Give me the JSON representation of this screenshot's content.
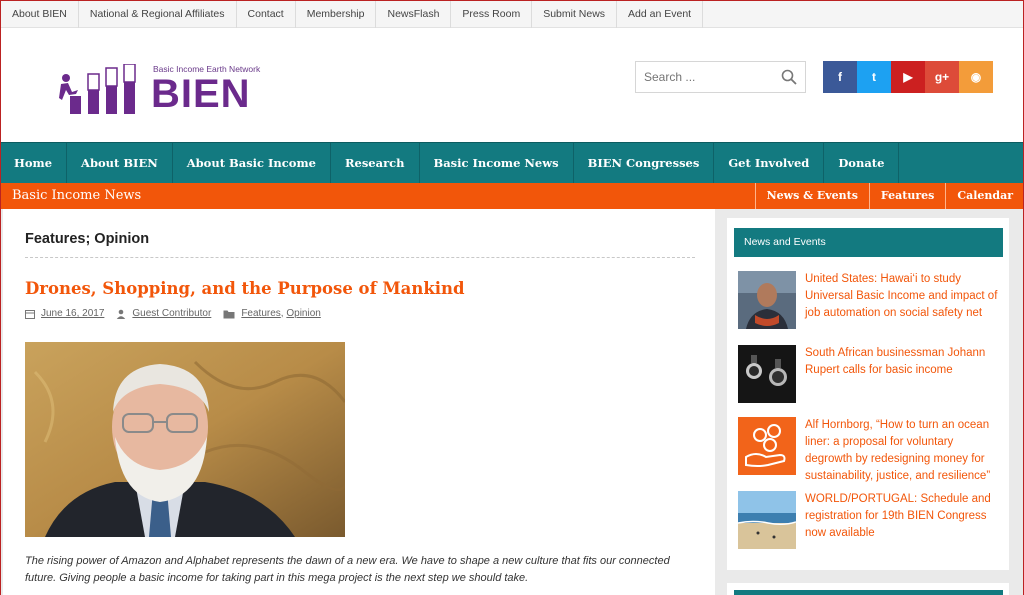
{
  "topbar": {
    "links": [
      "About BIEN",
      "National & Regional Affiliates",
      "Contact",
      "Membership",
      "NewsFlash",
      "Press Room",
      "Submit News",
      "Add an Event"
    ]
  },
  "logo": {
    "subtitle": "Basic Income Earth Network",
    "name": "BIEN"
  },
  "search": {
    "placeholder": "Search ..."
  },
  "social": [
    {
      "icon": "facebook-icon",
      "glyph": "f",
      "color": "#3b5998"
    },
    {
      "icon": "twitter-icon",
      "glyph": "t",
      "color": "#1da1f2"
    },
    {
      "icon": "youtube-icon",
      "glyph": "▶",
      "color": "#cc2020"
    },
    {
      "icon": "google-plus-icon",
      "glyph": "g+",
      "color": "#dd4b39"
    },
    {
      "icon": "rss-icon",
      "glyph": "◉",
      "color": "#f39c3a"
    }
  ],
  "mainnav": {
    "items": [
      "Home",
      "About BIEN",
      "About Basic Income",
      "Research",
      "Basic Income News",
      "BIEN Congresses",
      "Get Involved",
      "Donate"
    ]
  },
  "catbar": {
    "title": "Basic Income News",
    "links": [
      "News & Events",
      "Features",
      "Calendar"
    ]
  },
  "main": {
    "page_title": "Features; Opinion",
    "post_title": "Drones, Shopping, and the Purpose of Mankind",
    "date": "June 16, 2017",
    "author": "Guest Contributor",
    "categories": [
      "Features",
      "Opinion"
    ],
    "category_separator": ", ",
    "excerpt": "The rising power of Amazon and Alphabet represents the dawn of a new era. We have to shape a new culture that fits our connected future. Giving people a basic income for taking part in this mega project is the next step we should take."
  },
  "sidebar": {
    "widget_title": "News and Events",
    "items": [
      {
        "title": "United States: Hawai‘i to study Universal Basic Income and impact of job automation on social safety net"
      },
      {
        "title": "South African businessman Johann Rupert calls for basic income"
      },
      {
        "title": "Alf Hornborg, “How to turn an ocean liner: a proposal for voluntary degrowth by redesigning money for sustainability, justice, and resilience”"
      },
      {
        "title": "WORLD/PORTUGAL: Schedule and registration for 19th BIEN Congress now available"
      }
    ]
  },
  "colors": {
    "teal": "#137a80",
    "orange": "#f2560a",
    "purple": "#6b2a8c"
  }
}
